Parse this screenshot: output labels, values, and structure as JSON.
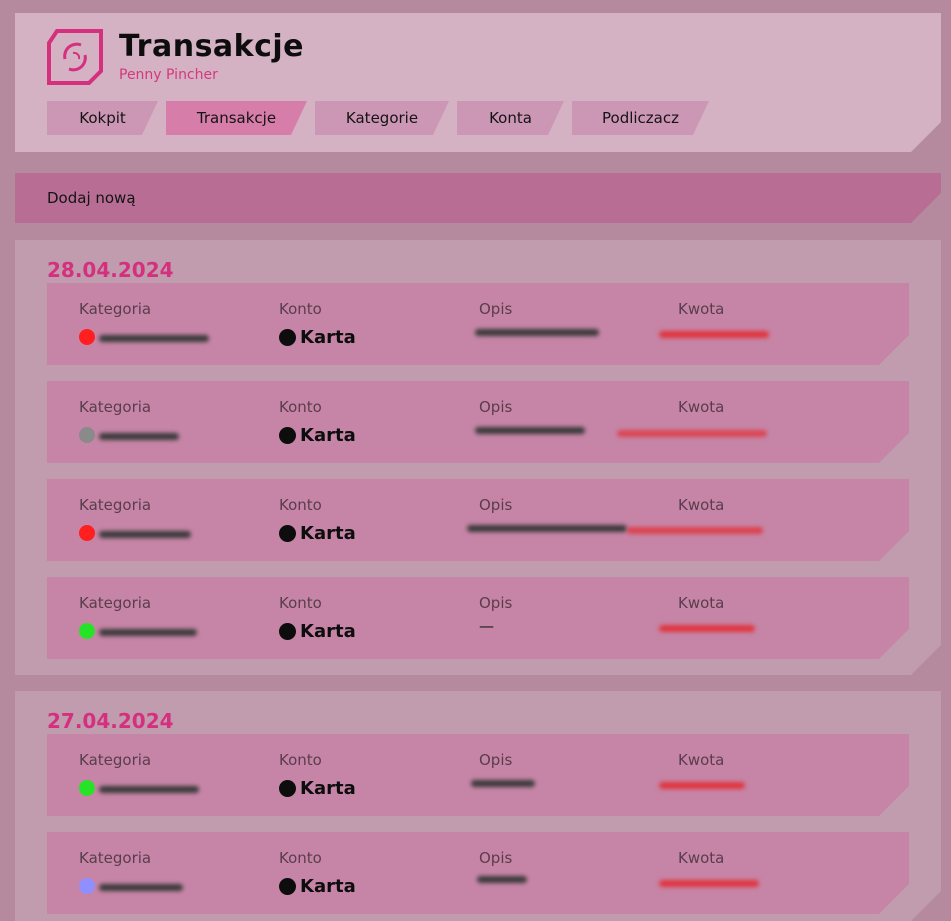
{
  "app": {
    "title": "Transakcje",
    "subtitle": "Penny Pincher"
  },
  "nav": [
    {
      "label": "Kokpit",
      "active": false
    },
    {
      "label": "Transakcje",
      "active": true
    },
    {
      "label": "Kategorie",
      "active": false
    },
    {
      "label": "Konta",
      "active": false
    },
    {
      "label": "Podliczacz",
      "active": false
    }
  ],
  "add_new_label": "Dodaj nową",
  "columns": {
    "category": "Kategoria",
    "account": "Konto",
    "description": "Opis",
    "amount": "Kwota"
  },
  "days": [
    {
      "date": "28.04.2024",
      "transactions": [
        {
          "category_color": "#ff1f1f",
          "account": "Karta",
          "account_color": "#0d0d0d",
          "description": "",
          "amount": ""
        },
        {
          "category_color": "#8a8a8a",
          "account": "Karta",
          "account_color": "#0d0d0d",
          "description": "",
          "amount": ""
        },
        {
          "category_color": "#ff1f1f",
          "account": "Karta",
          "account_color": "#0d0d0d",
          "description": "",
          "amount": ""
        },
        {
          "category_color": "#27e327",
          "account": "Karta",
          "account_color": "#0d0d0d",
          "description": "—",
          "amount": ""
        }
      ]
    },
    {
      "date": "27.04.2024",
      "transactions": [
        {
          "category_color": "#27e327",
          "account": "Karta",
          "account_color": "#0d0d0d",
          "description": "",
          "amount": ""
        },
        {
          "category_color": "#8f8fff",
          "account": "Karta",
          "account_color": "#0d0d0d",
          "description": "",
          "amount": ""
        }
      ]
    }
  ],
  "colors": {
    "page_bg": "#b58a9f",
    "panel_bg": "#d4b2c4",
    "accent": "#d4307e",
    "card_bg": "#c685a6",
    "nav_active": "#d67daa",
    "redacted_amount": "#e0353f",
    "redacted_text": "#3a3a3a"
  }
}
